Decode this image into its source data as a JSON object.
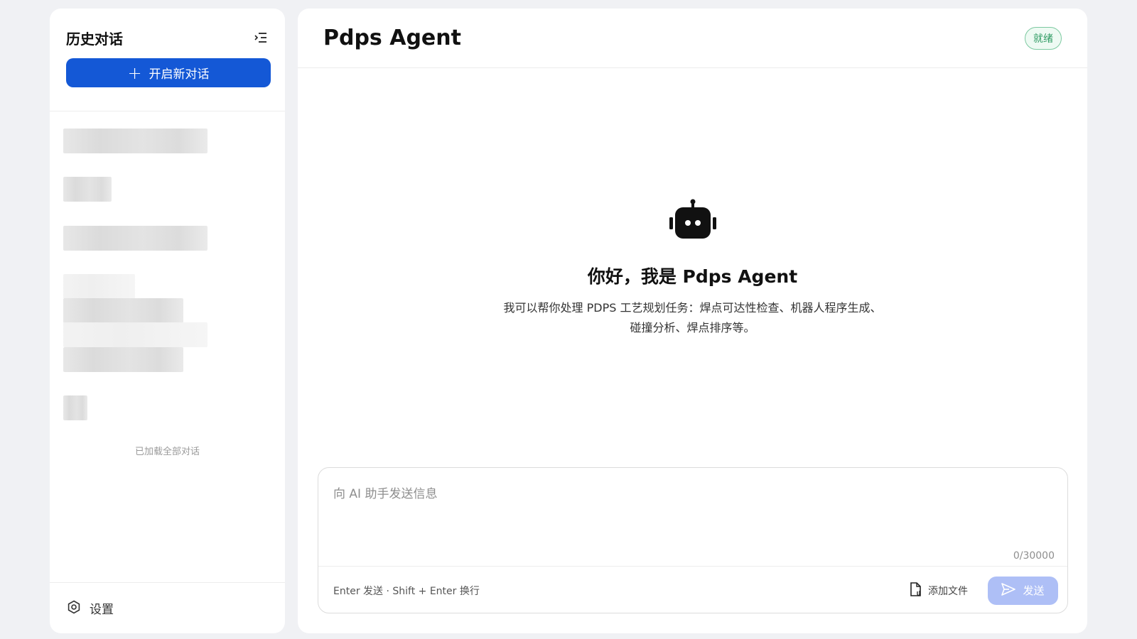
{
  "sidebar": {
    "title": "历史对话",
    "new_chat_label": "开启新对话",
    "loaded_note": "已加载全部对话",
    "settings_label": "设置",
    "icons": {
      "collapse": "menu-collapse-icon",
      "new_chat": "plus-icon",
      "settings": "gear-icon"
    }
  },
  "main": {
    "title": "Pdps Agent",
    "status": "就绪",
    "welcome_title": "你好，我是 Pdps Agent",
    "welcome_desc": "我可以帮你处理 PDPS 工艺规划任务：焊点可达性检查、机器人程序生成、碰撞分析、焊点排序等。",
    "icon": "robot-icon"
  },
  "composer": {
    "placeholder": "向 AI 助手发送信息",
    "value": "",
    "char_count": "0/30000",
    "hint": "Enter 发送 · Shift + Enter 换行",
    "add_file_label": "添加文件",
    "send_label": "发送",
    "icons": {
      "add_file": "file-attach-icon",
      "send": "send-icon"
    }
  },
  "colors": {
    "accent": "#1458d6",
    "send_disabled": "#aebff6",
    "status_green": "#2f9b63",
    "background": "#f0f1f4"
  }
}
